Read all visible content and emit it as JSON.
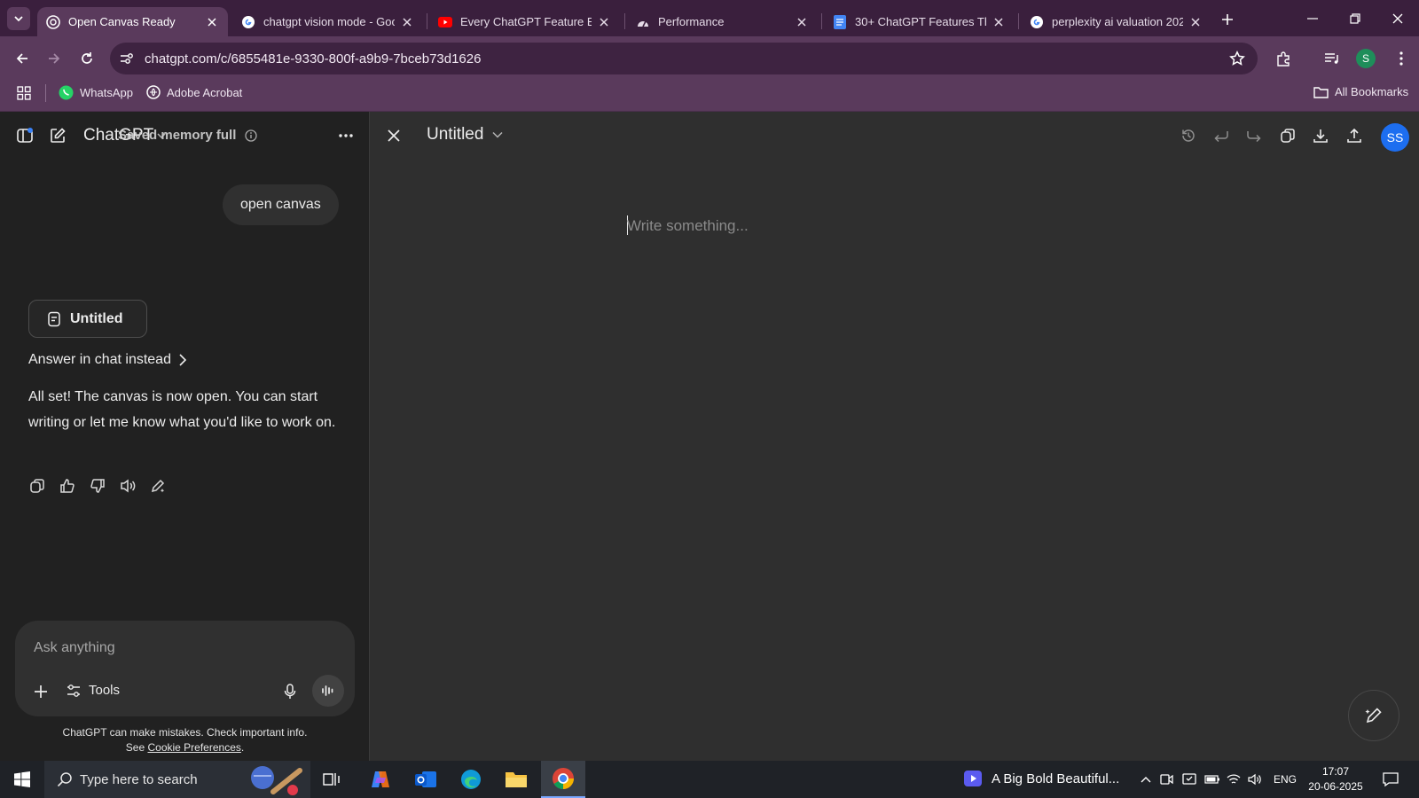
{
  "browser": {
    "tabs": [
      {
        "title": "Open Canvas Ready",
        "icon": "chatgpt-icon",
        "active": true
      },
      {
        "title": "chatgpt vision mode - Goo",
        "icon": "google-icon",
        "active": false
      },
      {
        "title": "Every ChatGPT Feature Exp",
        "icon": "youtube-icon",
        "active": false
      },
      {
        "title": "Performance",
        "icon": "performance-icon",
        "active": false
      },
      {
        "title": "30+ ChatGPT Features Tha",
        "icon": "docs-icon",
        "active": false
      },
      {
        "title": "perplexity ai valuation 202",
        "icon": "google-icon",
        "active": false
      }
    ],
    "url": "chatgpt.com/c/6855481e-9330-800f-a9b9-7bceb73d1626",
    "profile_initial": "S",
    "bookmarks": [
      {
        "label": "WhatsApp",
        "icon": "whatsapp-icon"
      },
      {
        "label": "Adobe Acrobat",
        "icon": "acrobat-icon"
      }
    ],
    "all_bookmarks": "All Bookmarks",
    "accent": "#5a3a5c"
  },
  "sidebar": {
    "title": "ChatGPT",
    "overlay_title": "Saved memory full",
    "chat": {
      "user_message": "open canvas",
      "doc_card_title": "Untitled",
      "answer_link": "Answer in chat instead",
      "assistant_message": "All set! The canvas is now open. You can start writing or let me know what you'd like to work on."
    },
    "composer": {
      "placeholder": "Ask anything",
      "tools_label": "Tools"
    },
    "disclaimer_line1": "ChatGPT can make mistakes. Check important info.",
    "disclaimer_see": "See",
    "disclaimer_link": "Cookie Preferences",
    "disclaimer_end": "."
  },
  "canvas": {
    "title": "Untitled",
    "placeholder": "Write something...",
    "user_initials": "SS",
    "avatar_color": "#1d6ef0"
  },
  "taskbar": {
    "search_placeholder": "Type here to search",
    "media_title": "A Big Bold Beautiful...",
    "language": "ENG",
    "time": "17:07",
    "date": "20-06-2025"
  }
}
